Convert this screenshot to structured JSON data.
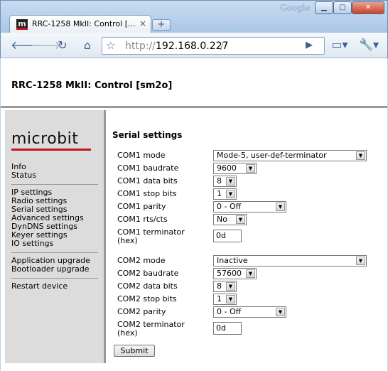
{
  "browser": {
    "watermark": "Google",
    "tab_title": "RRC-1258 MkII: Control [...",
    "favicon_letter": "m",
    "tab_close": "×",
    "new_tab": "+",
    "url_scheme": "http://",
    "url_host": "192.168.0.227",
    "url_rest": "/"
  },
  "page": {
    "title": "RRC-1258 MkII: Control [sm2o]",
    "logo_text": "microbit"
  },
  "sidebar": {
    "groups": [
      [
        "Info",
        "Status"
      ],
      [
        "IP settings",
        "Radio settings",
        "Serial settings",
        "Advanced settings",
        "DynDNS settings",
        "Keyer settings",
        "IO settings"
      ],
      [
        "Application upgrade",
        "Bootloader upgrade"
      ],
      [
        "Restart device"
      ]
    ]
  },
  "form": {
    "section_title": "Serial settings",
    "com1": {
      "mode": {
        "label": "COM1 mode",
        "value": "Mode-5, user-def-terminator"
      },
      "baudrate": {
        "label": "COM1 baudrate",
        "value": "9600"
      },
      "data_bits": {
        "label": "COM1 data bits",
        "value": "8"
      },
      "stop_bits": {
        "label": "COM1 stop bits",
        "value": "1"
      },
      "parity": {
        "label": "COM1 parity",
        "value": "0 - Off"
      },
      "rts_cts": {
        "label": "COM1 rts/cts",
        "value": "No"
      },
      "terminator": {
        "label_line1": "COM1 terminator",
        "label_line2": "(hex)",
        "value": "0d"
      }
    },
    "com2": {
      "mode": {
        "label": "COM2 mode",
        "value": "Inactive"
      },
      "baudrate": {
        "label": "COM2 baudrate",
        "value": "57600"
      },
      "data_bits": {
        "label": "COM2 data bits",
        "value": "8"
      },
      "stop_bits": {
        "label": "COM2 stop bits",
        "value": "1"
      },
      "parity": {
        "label": "COM2 parity",
        "value": "0 - Off"
      },
      "terminator": {
        "label_line1": "COM2 terminator",
        "label_line2": "(hex)",
        "value": "0d"
      }
    },
    "submit_label": "Submit"
  },
  "colors": {
    "logo_bar": "#c3151b",
    "sidebar_bg": "#dcdcdc"
  }
}
